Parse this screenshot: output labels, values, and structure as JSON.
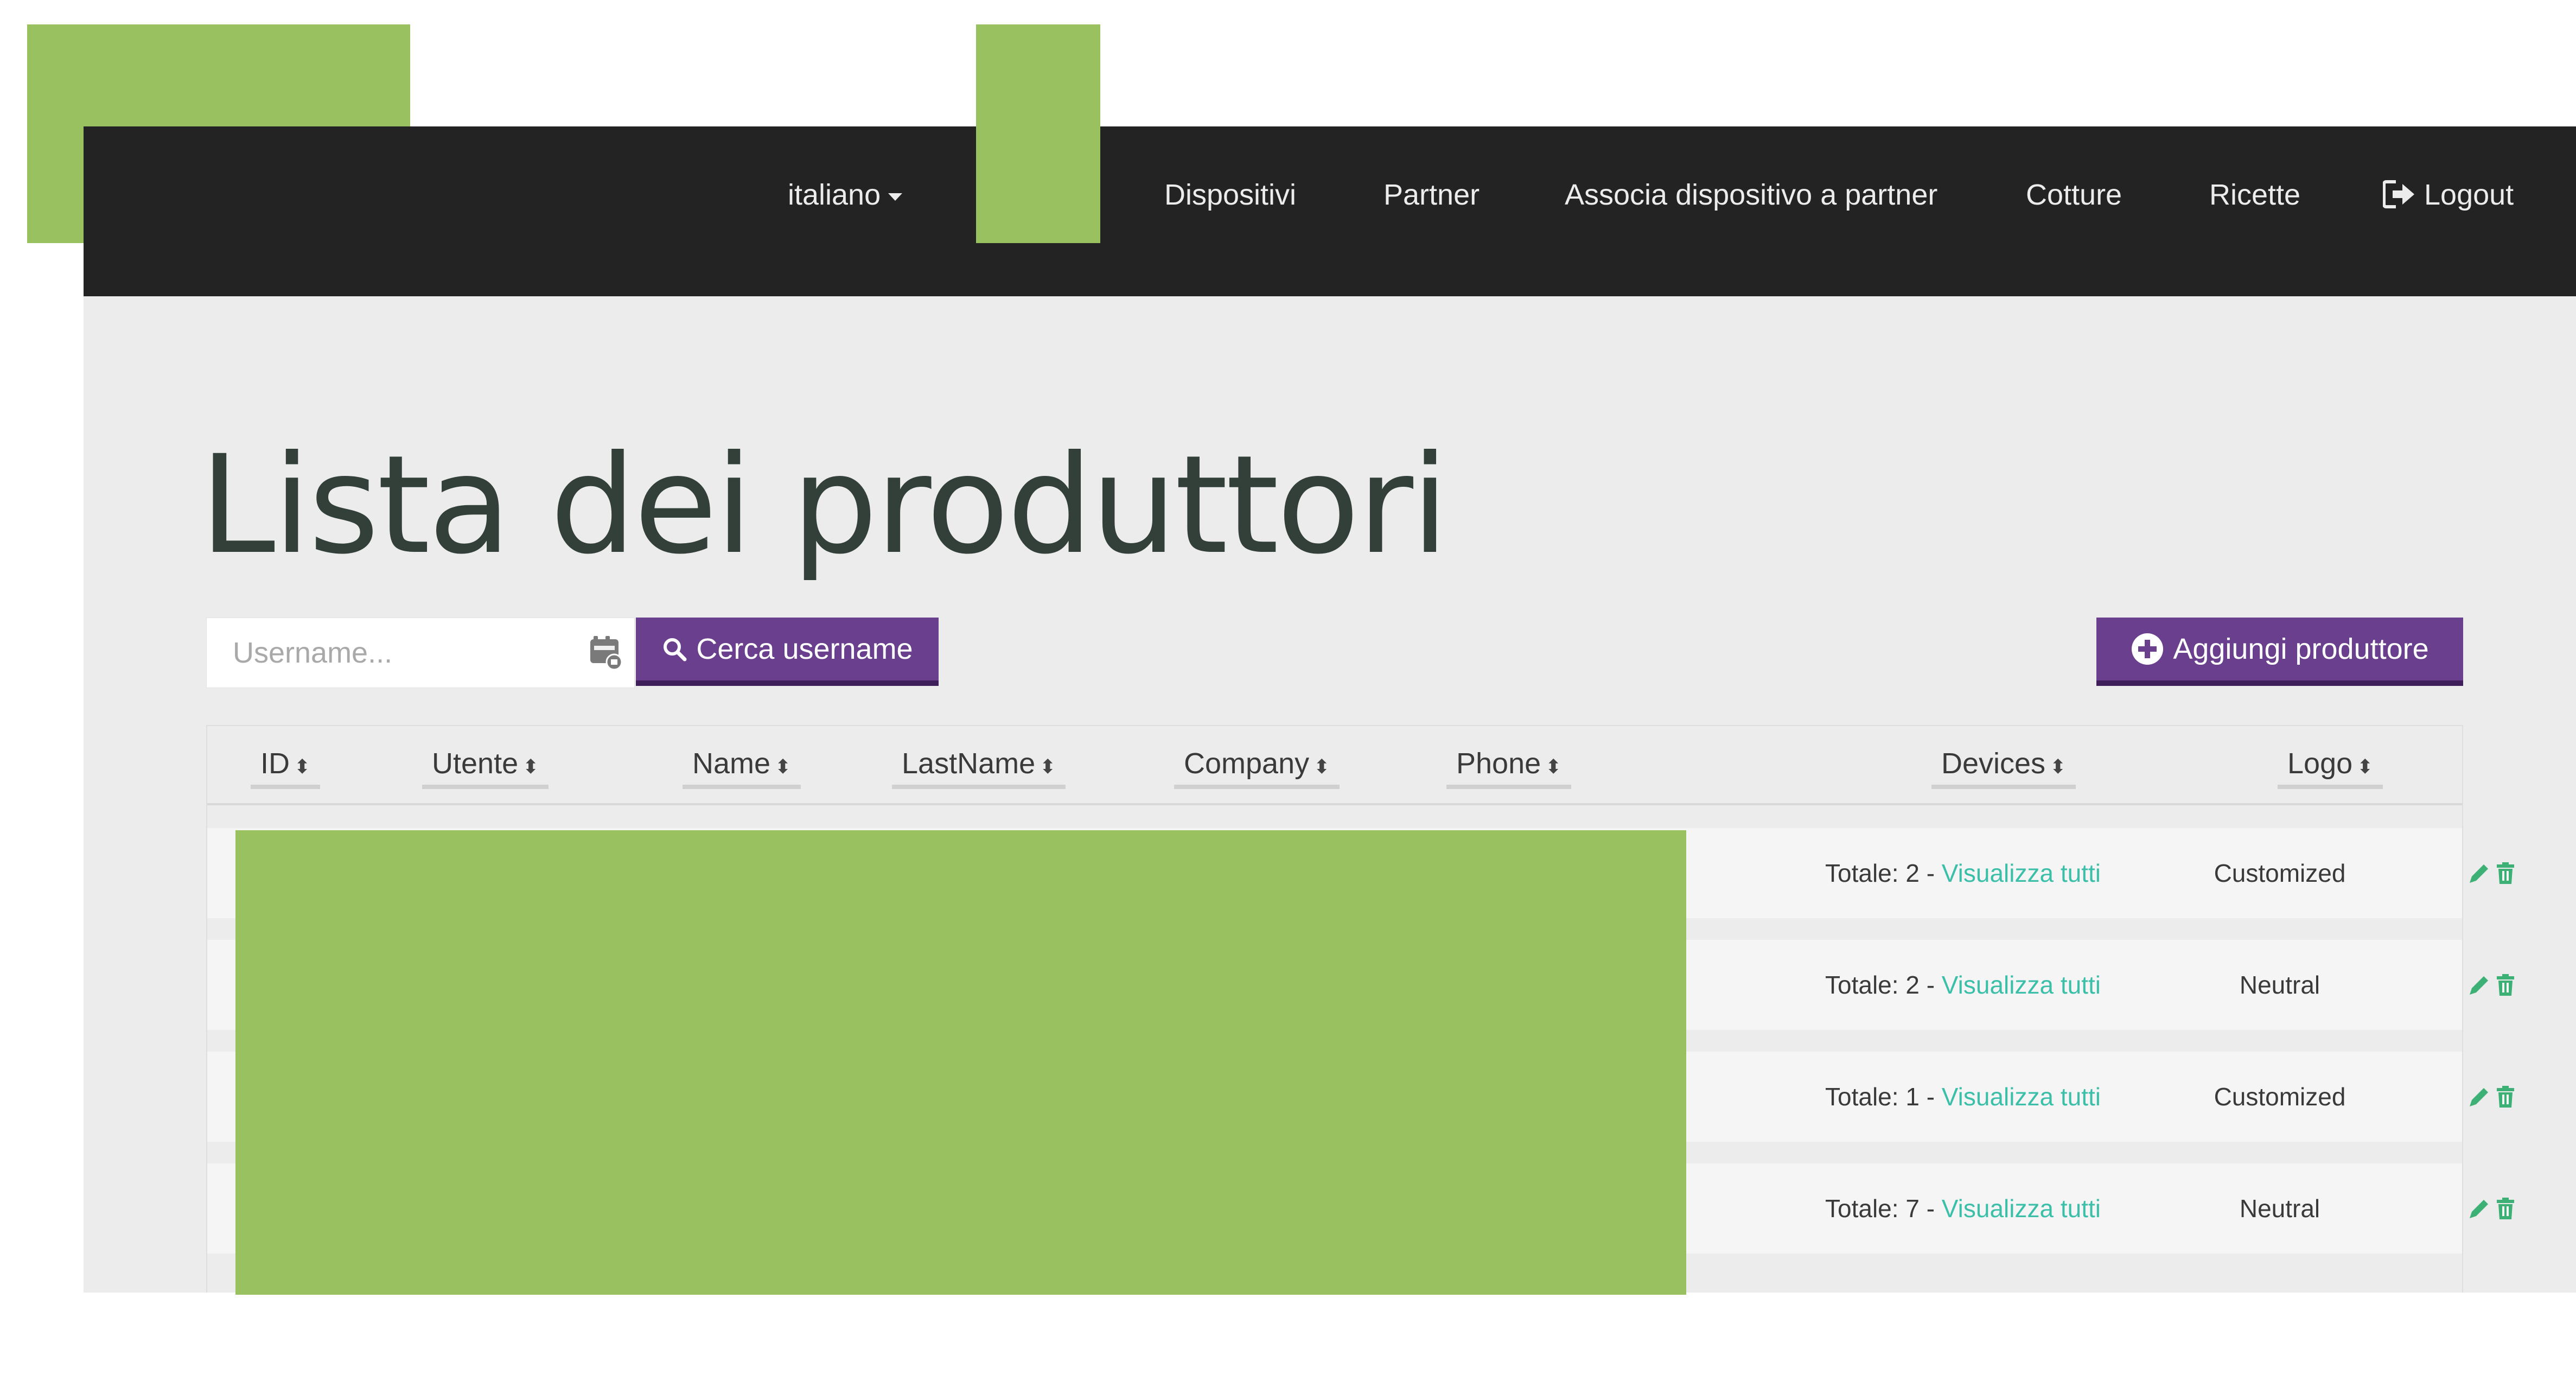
{
  "navbar": {
    "language": "italiano",
    "items": [
      "Dispositivi",
      "Partner",
      "Associa dispositivo a partner",
      "Cotture",
      "Ricette"
    ],
    "logout": "Logout"
  },
  "page": {
    "title": "Lista dei produttori"
  },
  "search": {
    "placeholder": "Username...",
    "button_label": "Cerca username",
    "add_button_label": "Aggiungi produttore"
  },
  "table": {
    "headers": [
      "ID",
      "Utente",
      "Name",
      "LastName",
      "Company",
      "Phone",
      "Devices",
      "Logo"
    ],
    "rows": [
      {
        "devices_prefix": "Totale: 2 - ",
        "devices_link": "Visualizza tutti",
        "logo": "Customized"
      },
      {
        "devices_prefix": "Totale: 2 - ",
        "devices_link": "Visualizza tutti",
        "logo": "Neutral"
      },
      {
        "devices_prefix": "Totale: 1 - ",
        "devices_link": "Visualizza tutti",
        "logo": "Customized"
      },
      {
        "devices_prefix": "Totale: 7 - ",
        "devices_link": "Visualizza tutti",
        "logo": "Neutral"
      }
    ]
  },
  "icons": {
    "language_dropdown": "caret-down-icon",
    "logout": "sign-out-icon",
    "search_field": "contact-card-icon",
    "search_button": "search-icon",
    "add_button": "plus-circle-icon",
    "sort": "sort-icon",
    "edit": "pencil-icon",
    "delete": "trash-icon"
  },
  "colors": {
    "navbar_bg": "#232323",
    "panel_bg": "#ececec",
    "button_purple": "#6a3f8e",
    "link_teal": "#3cbfa9",
    "action_green": "#3cb075",
    "redaction_green": "#99c15f"
  }
}
